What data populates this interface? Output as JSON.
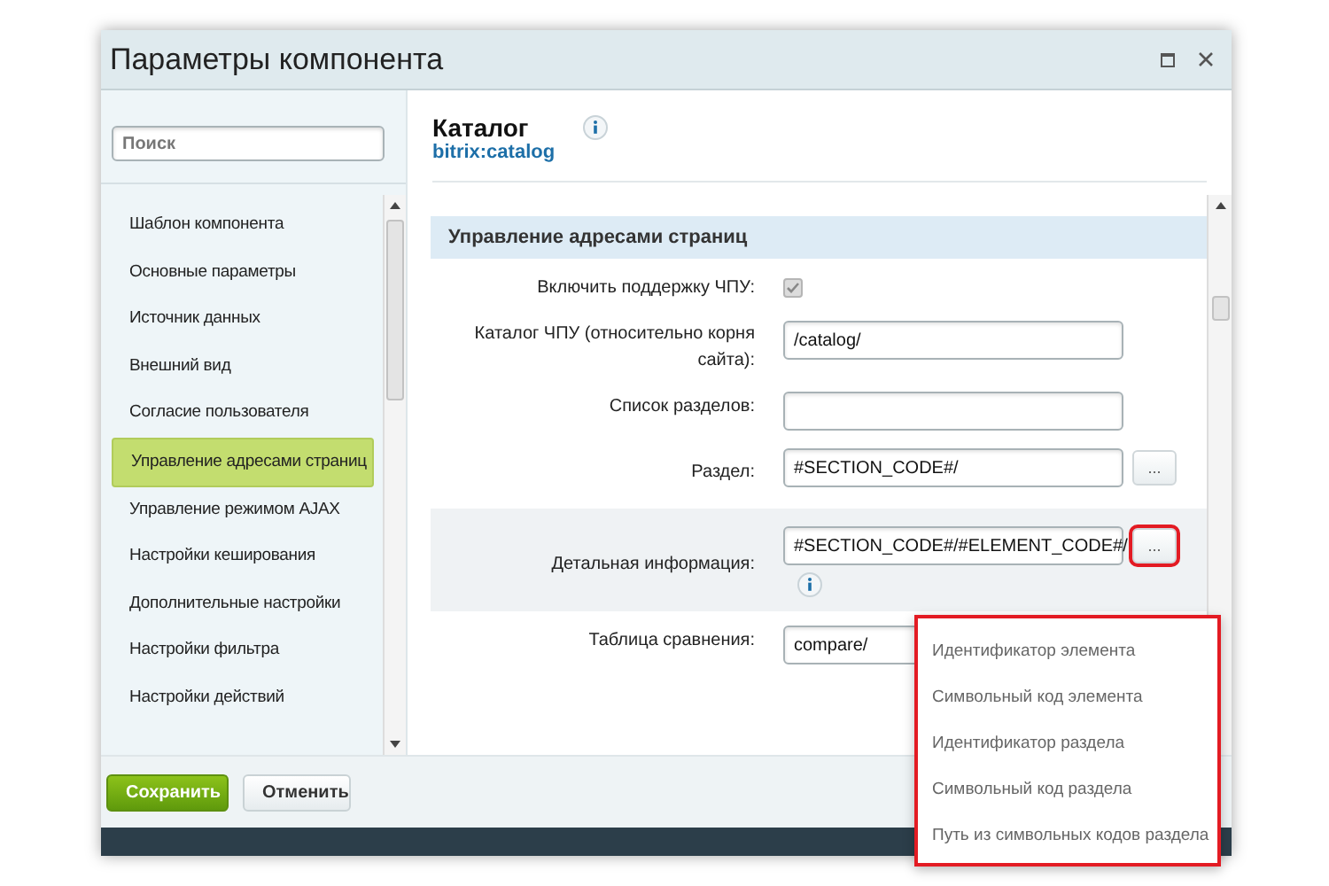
{
  "window": {
    "title": "Параметры компонента"
  },
  "sidebar": {
    "search": {
      "placeholder": "Поиск"
    },
    "items": [
      {
        "label": "Шаблон компонента",
        "selected": false
      },
      {
        "label": "Основные параметры",
        "selected": false
      },
      {
        "label": "Источник данных",
        "selected": false
      },
      {
        "label": "Внешний вид",
        "selected": false
      },
      {
        "label": "Согласие пользователя",
        "selected": false
      },
      {
        "label": "Управление адресами страниц",
        "selected": true
      },
      {
        "label": "Управление режимом AJAX",
        "selected": false
      },
      {
        "label": "Настройки кеширования",
        "selected": false
      },
      {
        "label": "Дополнительные настройки",
        "selected": false
      },
      {
        "label": "Настройки фильтра",
        "selected": false
      },
      {
        "label": "Настройки действий",
        "selected": false
      }
    ]
  },
  "component": {
    "name": "Каталог",
    "code": "bitrix:catalog"
  },
  "section": {
    "title": "Управление адресами страниц"
  },
  "fields": [
    {
      "kind": "checkbox",
      "label": "Включить поддержку ЧПУ:",
      "checked": true
    },
    {
      "kind": "text",
      "label": "Каталог ЧПУ (относительно корня сайта):",
      "value": "/catalog/"
    },
    {
      "kind": "text",
      "label": "Список разделов:"
    },
    {
      "kind": "template",
      "label": "Раздел:",
      "value": "#SECTION_CODE#/",
      "button": "...",
      "active": false,
      "info": false
    },
    {
      "kind": "template",
      "label": "Детальная информация:",
      "value": "#SECTION_CODE#/#ELEMENT_CODE#/",
      "button": "...",
      "active": true,
      "info": true
    },
    {
      "kind": "text",
      "label": "Таблица сравнения:",
      "value": "compare/"
    }
  ],
  "dropdown": {
    "items": [
      "Идентификатор элемента",
      "Символьный код элемента",
      "Идентификатор раздела",
      "Символьный код раздела",
      "Путь из символьных кодов раздела"
    ]
  },
  "buttons": [
    {
      "kind": "primary",
      "label": "Сохранить"
    },
    {
      "kind": "secondary",
      "label": "Отменить"
    }
  ]
}
